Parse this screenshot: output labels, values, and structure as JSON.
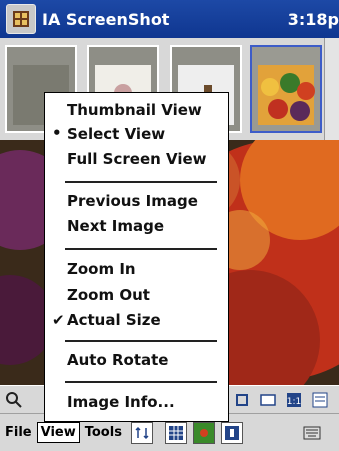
{
  "titlebar": {
    "title": "IA ScreenShot",
    "time": "3:18p"
  },
  "menubar": {
    "file": "File",
    "view": "View",
    "tools": "Tools"
  },
  "menu": {
    "items": [
      {
        "label": "Thumbnail View",
        "mark": ""
      },
      {
        "label": "Select View",
        "mark": "•"
      },
      {
        "label": "Full Screen View",
        "mark": ""
      },
      {
        "label": "Previous Image",
        "mark": ""
      },
      {
        "label": "Next Image",
        "mark": ""
      },
      {
        "label": "Zoom In",
        "mark": ""
      },
      {
        "label": "Zoom Out",
        "mark": ""
      },
      {
        "label": "Actual Size",
        "mark": "✔"
      },
      {
        "label": "Auto Rotate",
        "mark": ""
      },
      {
        "label": "Image Info...",
        "mark": ""
      }
    ]
  },
  "colors": {
    "title_bar": "#1d49a6",
    "menu_bg": "#ffffff",
    "selected_thumb_border": "#3d5cc8"
  }
}
